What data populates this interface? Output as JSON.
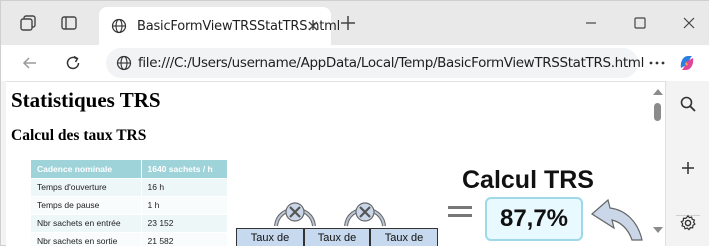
{
  "browser": {
    "tab": {
      "title": "BasicFormViewTRSStatTRS.html"
    },
    "address_bar": {
      "url": "file:///C:/Users/username/AppData/Local/Temp/BasicFormViewTRSStatTRS.html"
    },
    "icons": {
      "workspaces": "workspaces-icon",
      "tab_actions": "tab-actions-icon",
      "back": "back-arrow-icon",
      "refresh": "refresh-icon",
      "more": "more-icon",
      "copilot": "copilot-icon",
      "search": "search-icon",
      "add": "add-icon",
      "settings": "gear-icon"
    },
    "colors": {
      "tab_strip": "#e9e9e9",
      "accent": "#0f6cbd"
    }
  },
  "page": {
    "heading": "Statistiques TRS",
    "subheading": "Calcul des taux TRS",
    "table": {
      "header": [
        "Cadence nominale",
        "1640 sachets / h"
      ],
      "rows": [
        [
          "Temps d'ouverture",
          "16 h"
        ],
        [
          "Temps de pause",
          "1 h"
        ],
        [
          "Nbr sachets en entrée",
          "23 152"
        ],
        [
          "Nbr sachets en sortie",
          "21 582"
        ]
      ]
    },
    "diagram": {
      "title": "Calcul TRS",
      "result": "87,7%",
      "rate_labels": [
        "Taux de",
        "Taux de",
        "Taux de"
      ]
    }
  }
}
